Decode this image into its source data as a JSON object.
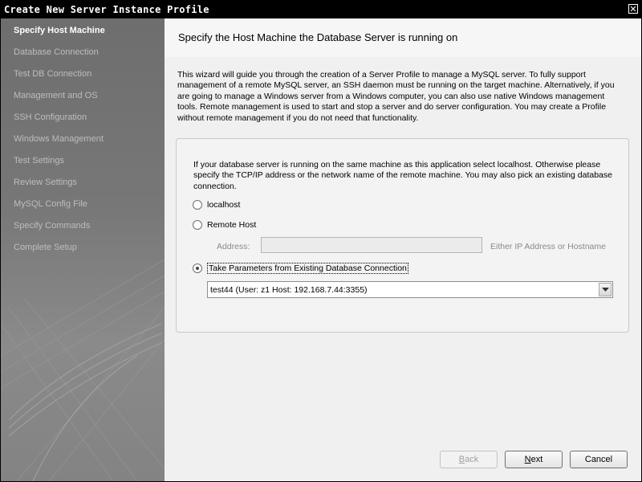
{
  "window": {
    "title": "Create New Server Instance Profile",
    "close_glyph": "✕"
  },
  "sidebar": {
    "items": [
      {
        "label": "Specify Host Machine",
        "active": true
      },
      {
        "label": "Database Connection"
      },
      {
        "label": "Test DB Connection"
      },
      {
        "label": "Management and OS"
      },
      {
        "label": "SSH Configuration"
      },
      {
        "label": "Windows Management"
      },
      {
        "label": "Test Settings"
      },
      {
        "label": "Review Settings"
      },
      {
        "label": "MySQL Config File"
      },
      {
        "label": "Specify Commands"
      },
      {
        "label": "Complete Setup"
      }
    ]
  },
  "main": {
    "title": "Specify the Host Machine the Database Server is running on",
    "intro": "This wizard will guide you through the creation of a Server Profile to manage a MySQL server. To fully support management of a remote MySQL server, an SSH daemon must be running on the target machine. Alternatively, if you are going to manage a Windows server from a Windows computer, you can also use native Windows management tools. Remote management is used to start and stop a server and do server configuration. You may create a Profile without remote management if you do not need that functionality.",
    "group_text": "If your database server is running on the same machine as this application select localhost. Otherwise please specify the TCP/IP address or the network name of the remote machine. You may also pick an existing database connection.",
    "options": {
      "localhost": "localhost",
      "remote": "Remote Host",
      "existing": "Take Parameters from Existing Database Connection",
      "selected": "existing"
    },
    "address": {
      "label": "Address:",
      "value": "",
      "hint": "Either IP Address or Hostname"
    },
    "connection_select": {
      "value": "test44 (User: z1  Host: 192.168.7.44:3355)"
    }
  },
  "buttons": {
    "back": {
      "label": "Back",
      "mnemonic": "B",
      "rest": "ack",
      "enabled": false
    },
    "next": {
      "label": "Next",
      "mnemonic": "N",
      "rest": "ext",
      "enabled": true
    },
    "cancel": {
      "label": "Cancel",
      "enabled": true
    }
  },
  "icons": {
    "close": "close-icon",
    "dropdown": "chevron-down-icon"
  }
}
